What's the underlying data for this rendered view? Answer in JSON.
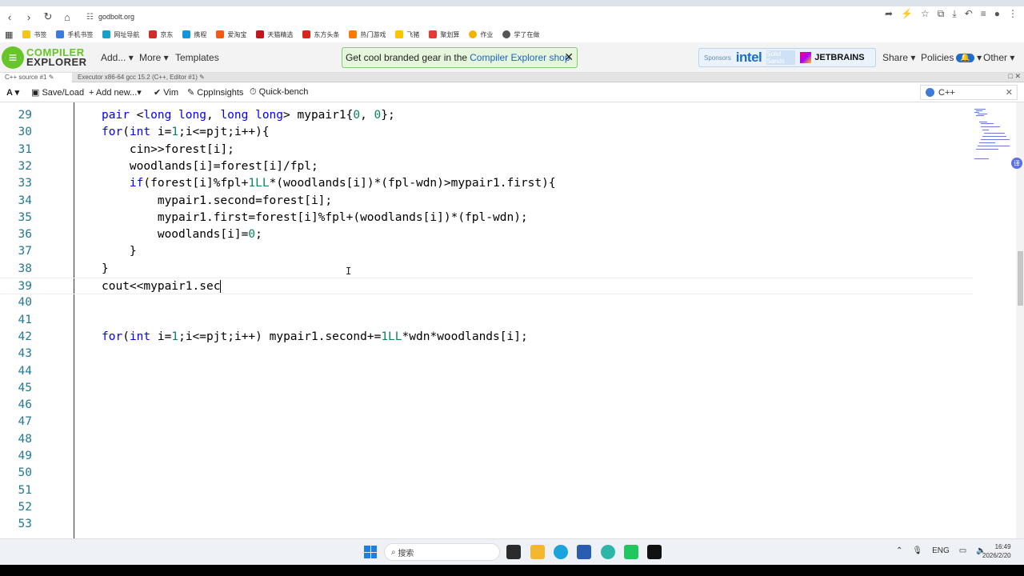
{
  "browser": {
    "url": "godbolt.org",
    "bookmarks": [
      "书签",
      "手机书签",
      "网址导航",
      "京东",
      "携程",
      "爱淘宝",
      "天猫精选",
      "东方头条",
      "热门游戏",
      "飞猪",
      "聚划算",
      "作业",
      "学了在做"
    ]
  },
  "header": {
    "logo_top": "COMPILER",
    "logo_bottom": "EXPLORER",
    "menu": [
      "Add...",
      "More",
      "Templates"
    ],
    "promo_text": "Get cool branded gear in the",
    "promo_link": "Compiler Explorer shop",
    "promo_close": "✕",
    "sponsors_label": "Sponsors",
    "sponsor_intel": "intel",
    "sponsor_solid": "Solid Sands",
    "sponsor_jetbrains": "JETBRAINS",
    "share": "Share",
    "policies": "Policies",
    "policies_badge": "🔔",
    "other": "Other"
  },
  "tabs": {
    "source": "C++ source #1",
    "executor": "Executor x86-64 gcc 15.2 (C++, Editor #1)"
  },
  "toolbar": {
    "font": "A",
    "save_load": "Save/Load",
    "add_new": "Add new...",
    "vim": "Vim",
    "cppinsights": "CppInsights",
    "quickbench": "Quick-bench",
    "language": "C++"
  },
  "editor": {
    "lines": [
      {
        "n": "29",
        "code": "pair <long long, long long> mypair1{0, 0};"
      },
      {
        "n": "30",
        "code": "for(int i=1;i<=pjt;i++){"
      },
      {
        "n": "31",
        "code": "    cin>>forest[i];"
      },
      {
        "n": "32",
        "code": "    woodlands[i]=forest[i]/fpl;"
      },
      {
        "n": "33",
        "code": "    if(forest[i]%fpl+1LL*(woodlands[i])*(fpl-wdn)>mypair1.first){"
      },
      {
        "n": "34",
        "code": "        mypair1.second=forest[i];"
      },
      {
        "n": "35",
        "code": "        mypair1.first=forest[i]%fpl+(woodlands[i])*(fpl-wdn);"
      },
      {
        "n": "36",
        "code": "        woodlands[i]=0;"
      },
      {
        "n": "37",
        "code": "    }"
      },
      {
        "n": "38",
        "code": "}"
      },
      {
        "n": "39",
        "code": "cout<<mypair1.sec"
      },
      {
        "n": "40",
        "code": ""
      },
      {
        "n": "41",
        "code": ""
      },
      {
        "n": "42",
        "code": "for(int i=1;i<=pjt;i++) mypair1.second+=1LL*wdn*woodlands[i];"
      },
      {
        "n": "43",
        "code": ""
      },
      {
        "n": "44",
        "code": ""
      },
      {
        "n": "45",
        "code": ""
      },
      {
        "n": "46",
        "code": ""
      },
      {
        "n": "47",
        "code": ""
      },
      {
        "n": "48",
        "code": ""
      },
      {
        "n": "49",
        "code": ""
      },
      {
        "n": "50",
        "code": ""
      },
      {
        "n": "51",
        "code": ""
      },
      {
        "n": "52",
        "code": ""
      },
      {
        "n": "53",
        "code": ""
      }
    ]
  },
  "taskbar": {
    "search": "搜索",
    "lang": "ENG",
    "time": "16:49",
    "date": "2026/2/20"
  }
}
